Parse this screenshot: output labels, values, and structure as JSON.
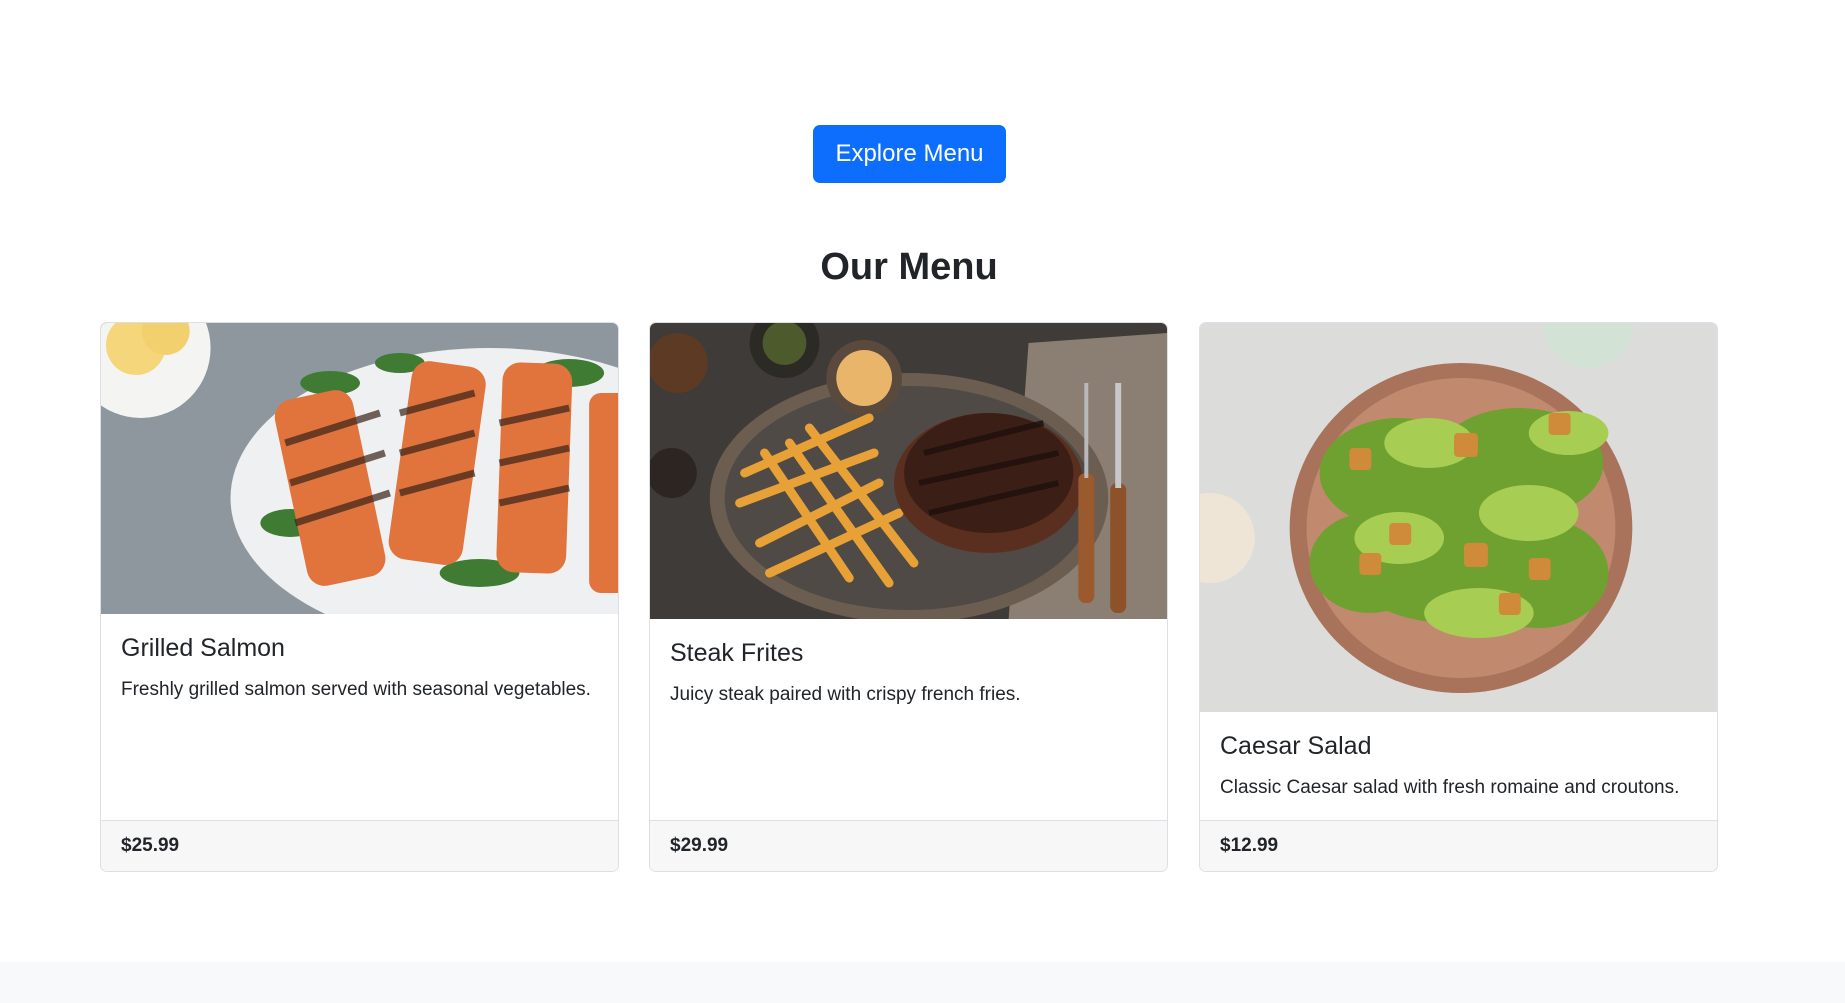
{
  "hero": {
    "button_label": "Explore Menu"
  },
  "menu": {
    "title": "Our Menu",
    "items": [
      {
        "name": "Grilled Salmon",
        "description": "Freshly grilled salmon served with seasonal vegetables.",
        "price": "$25.99",
        "image": "grilled-salmon-photo"
      },
      {
        "name": "Steak Frites",
        "description": "Juicy steak paired with crispy french fries.",
        "price": "$29.99",
        "image": "steak-frites-photo"
      },
      {
        "name": "Caesar Salad",
        "description": "Classic Caesar salad with fresh romaine and croutons.",
        "price": "$12.99",
        "image": "caesar-salad-photo"
      }
    ]
  },
  "colors": {
    "primary": "#0d6efd",
    "text": "#212529",
    "card_border": "#dcdfe3",
    "footer_bg": "#f8f9fa"
  }
}
